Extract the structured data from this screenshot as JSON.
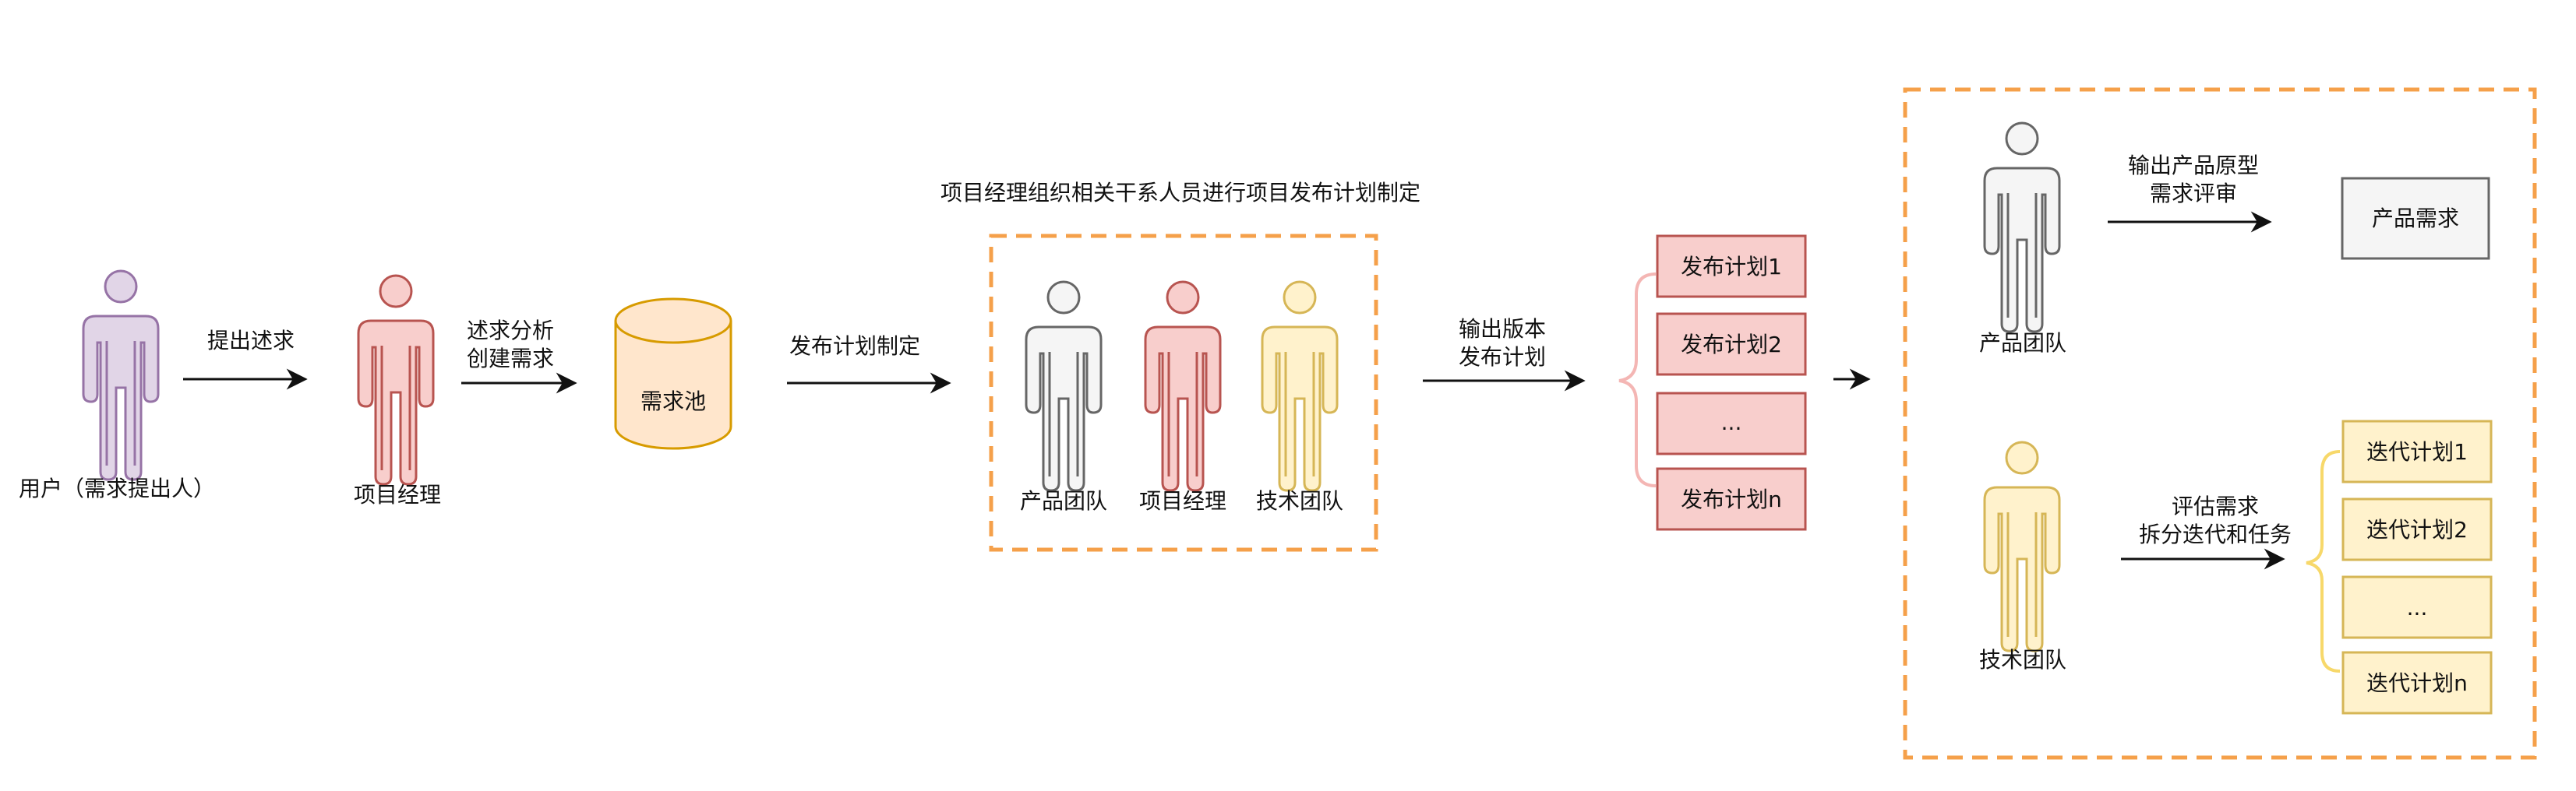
{
  "actors": {
    "user": "用户（需求提出人）",
    "pm": "项目经理",
    "group_product": "产品团队",
    "group_pm": "项目经理",
    "group_tech": "技术团队",
    "right_product": "产品团队",
    "right_tech": "技术团队"
  },
  "nodes": {
    "pool": "需求池",
    "product_req": "产品需求"
  },
  "edges": {
    "raise": "提出述求",
    "analyze_1": "述求分析",
    "analyze_2": "创建需求",
    "plan": "发布计划制定",
    "output_1": "输出版本",
    "output_2": "发布计划",
    "proto_1": "输出产品原型",
    "proto_2": "需求评审",
    "eval_1": "评估需求",
    "eval_2": "拆分迭代和任务"
  },
  "group_title": "项目经理组织相关干系人员进行项目发布计划制定",
  "release_plans": [
    "发布计划1",
    "发布计划2",
    "...",
    "发布计划n"
  ],
  "iteration_plans": [
    "迭代计划1",
    "迭代计划2",
    "...",
    "迭代计划n"
  ],
  "colors": {
    "purple_fill": "#e1d5e7",
    "purple_stroke": "#9673a6",
    "red_fill": "#f8cecc",
    "red_stroke": "#b85450",
    "grey_fill": "#f5f5f5",
    "grey_stroke": "#666666",
    "yellow_fill": "#fff2cc",
    "yellow_stroke": "#d6b656",
    "orange_fill": "#ffe6cc",
    "orange_stroke": "#d79b00",
    "dash_orange": "#f5a04a",
    "brace_red": "#f4b6b4",
    "brace_yellow": "#f7d86a"
  }
}
